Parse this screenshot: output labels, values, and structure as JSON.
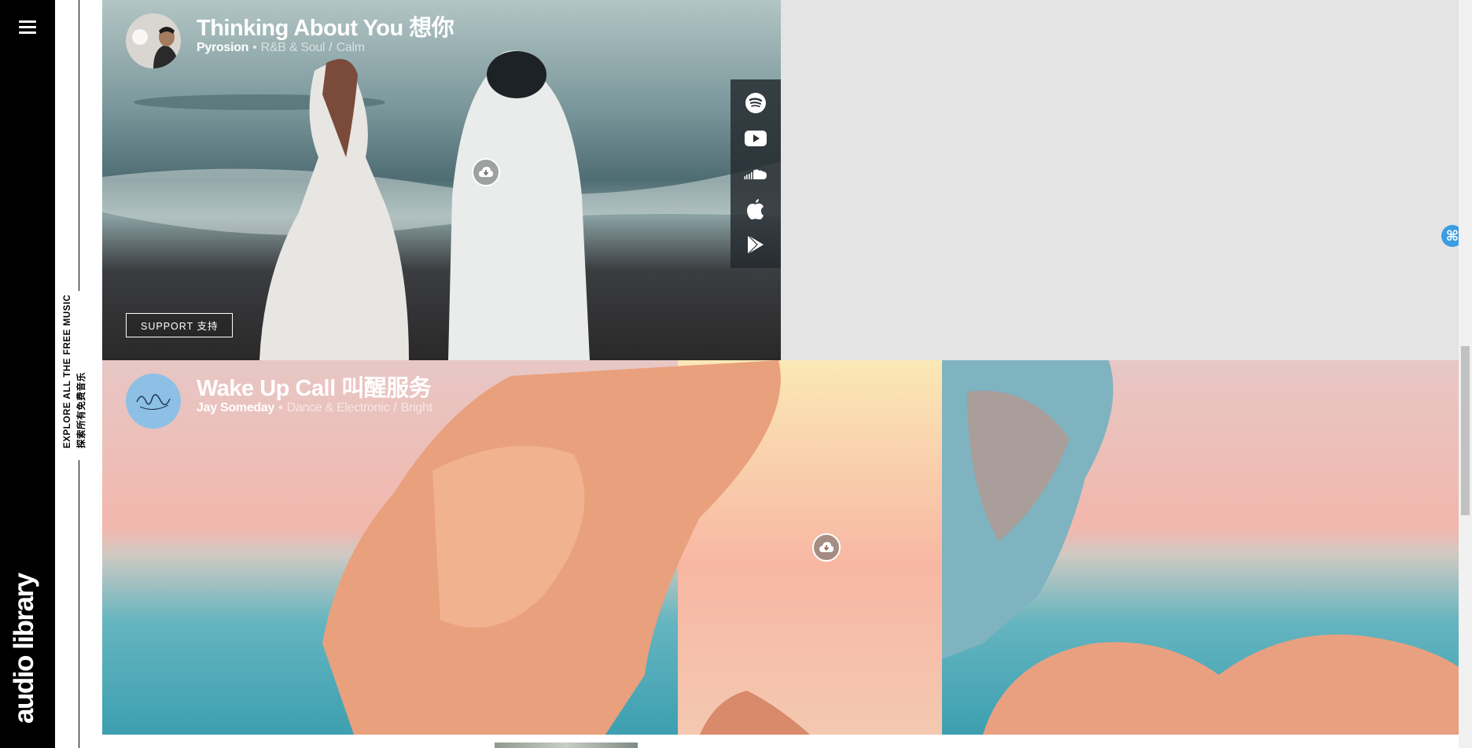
{
  "sidebar": {
    "brand": "audio library",
    "menu_icon": "hamburger-menu-icon"
  },
  "explore": {
    "line1": "EXPLORE ALL THE FREE MUSIC",
    "line2": "探索所有免费音乐"
  },
  "tracks": [
    {
      "title": "Thinking About You 想你",
      "artist": "Pyrosion",
      "genre": "R&B & Soul",
      "mood": "Calm",
      "support_label": "SUPPORT 支持",
      "download_icon": "cloud-download-icon"
    },
    {
      "title": "Wake Up Call 叫醒服务",
      "artist": "Jay Someday",
      "genre": "Dance & Electronic",
      "mood": "Bright",
      "download_icon": "cloud-download-icon"
    }
  ],
  "streaming": {
    "icons": [
      "spotify-icon",
      "youtube-icon",
      "soundcloud-icon",
      "apple-icon",
      "google-play-icon"
    ]
  },
  "floating_badge": "⌘",
  "colors": {
    "sidebar_bg": "#000000",
    "gray_panel": "#e4e4e4",
    "badge_blue": "#3a9ce3"
  }
}
